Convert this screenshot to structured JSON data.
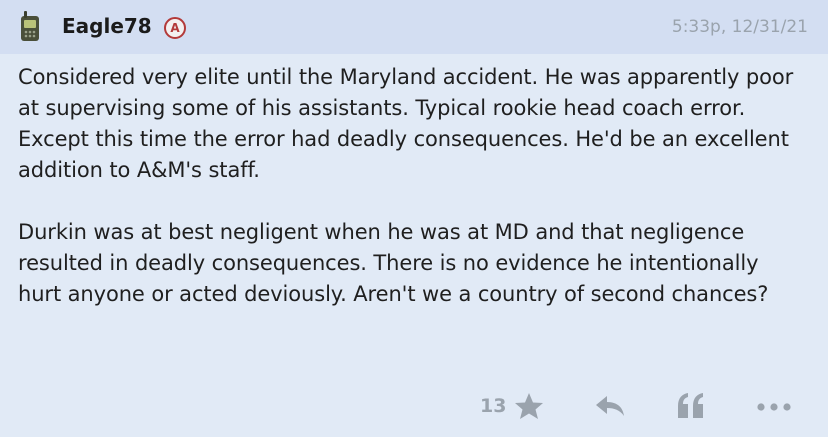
{
  "header": {
    "username": "Eagle78",
    "badge_letter": "A",
    "timestamp": "5:33p, 12/31/21",
    "device_icon": "phone-icon"
  },
  "body": {
    "paragraphs": [
      "Considered very elite until the Maryland accident. He was apparently poor at supervising some of his assistants. Typical rookie head coach error. Except this time the error had deadly consequences. He'd be an excellent addition to A&M's staff.",
      "Durkin was at best negligent when he was at MD and that negligence resulted in deadly consequences. There is no evidence he intentionally hurt anyone or acted deviously. Aren't we a country of second chances?"
    ]
  },
  "footer": {
    "rating_count": "13",
    "icons": [
      "star-icon",
      "reply-icon",
      "quote-icon",
      "more-icon"
    ]
  },
  "colors": {
    "post_background": "#e1eaf6",
    "header_background": "#d3def2",
    "muted_icon": "#9aa3ad",
    "badge_accent": "#b33a3a"
  }
}
